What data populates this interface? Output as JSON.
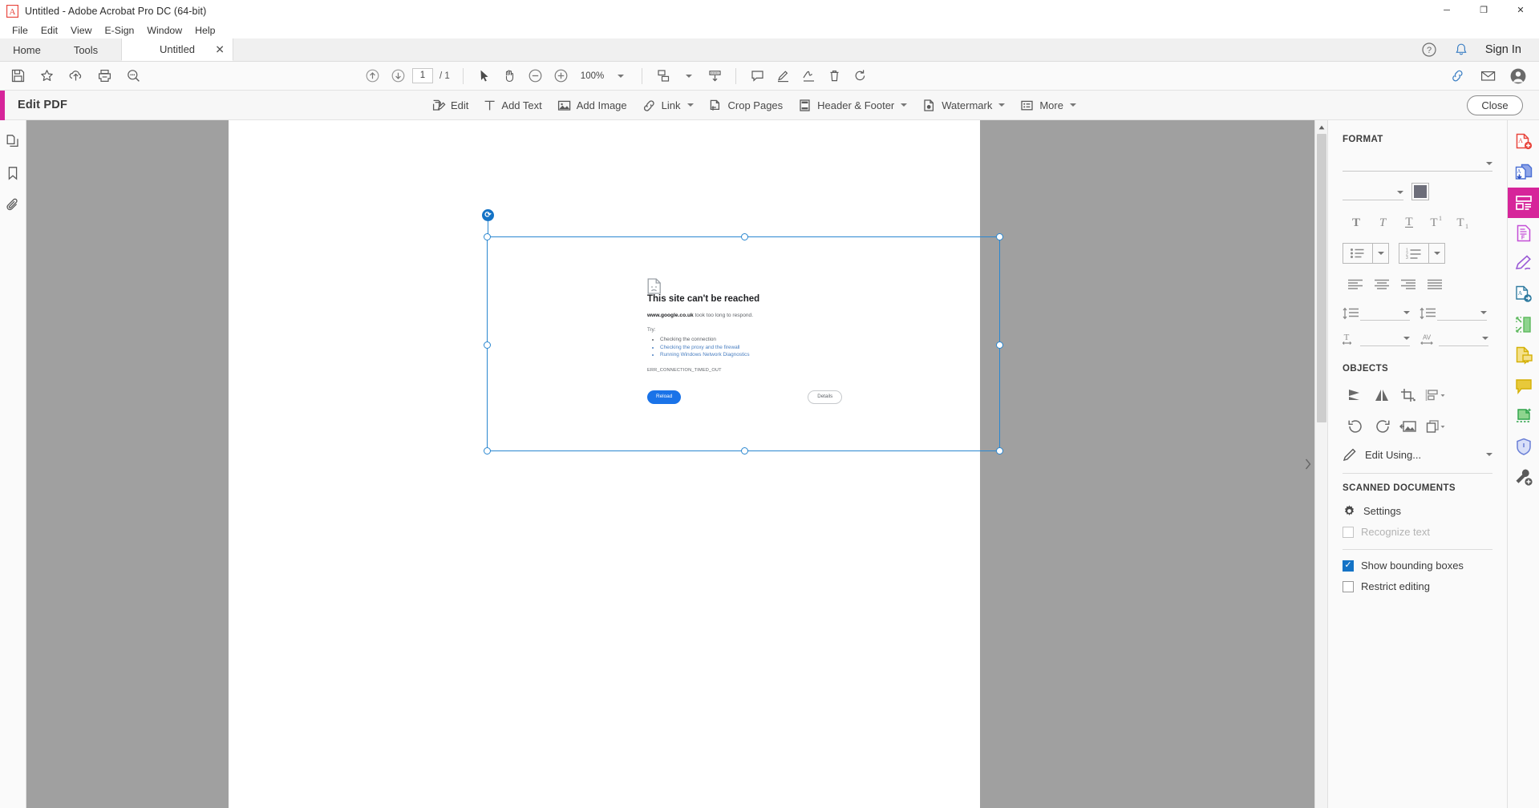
{
  "window": {
    "title": "Untitled - Adobe Acrobat Pro DC (64-bit)",
    "minimize": "─",
    "maximize": "❐",
    "close": "✕"
  },
  "menubar": {
    "items": [
      "File",
      "Edit",
      "View",
      "E-Sign",
      "Window",
      "Help"
    ]
  },
  "tabs": {
    "home": "Home",
    "tools": "Tools",
    "document": "Untitled",
    "close_glyph": "✕",
    "sign_in": "Sign In"
  },
  "toolbar": {
    "save_icon": "save-icon",
    "star_icon": "star-icon",
    "cloud_upload_icon": "cloud-upload-icon",
    "print_icon": "print-icon",
    "find_icon": "find-icon",
    "prev_page_icon": "arrow-up-circle-icon",
    "next_page_icon": "arrow-down-circle-icon",
    "page_number": "1",
    "page_total": "/ 1",
    "select_tool_icon": "cursor-icon",
    "hand_tool_icon": "hand-icon",
    "zoom_out_icon": "zoom-out-icon",
    "zoom_in_icon": "zoom-in-icon",
    "zoom_level": "100%",
    "fit_page_icon": "fit-page-icon",
    "scroll_mode_icon": "scroll-mode-icon",
    "comment_icon": "comment-icon",
    "highlight_icon": "highlight-pen-icon",
    "sign_icon": "sign-icon",
    "delete_icon": "trash-icon",
    "rotate_icon": "rotate-icon",
    "link_share_icon": "share-link-icon",
    "email_icon": "envelope-icon",
    "account_icon": "account-icon"
  },
  "editbar": {
    "title": "Edit PDF",
    "tools": [
      {
        "label": "Edit",
        "icon": "edit-pdf-icon",
        "caret": false
      },
      {
        "label": "Add Text",
        "icon": "add-text-icon",
        "caret": false
      },
      {
        "label": "Add Image",
        "icon": "add-image-icon",
        "caret": false
      },
      {
        "label": "Link",
        "icon": "link-icon",
        "caret": true
      },
      {
        "label": "Crop Pages",
        "icon": "crop-pages-icon",
        "caret": false
      },
      {
        "label": "Header & Footer",
        "icon": "header-footer-icon",
        "caret": true
      },
      {
        "label": "Watermark",
        "icon": "watermark-icon",
        "caret": true
      },
      {
        "label": "More",
        "icon": "more-list-icon",
        "caret": true
      }
    ],
    "close_label": "Close"
  },
  "leftrail": {
    "items": [
      {
        "name": "page-thumbnails-icon"
      },
      {
        "name": "bookmarks-icon"
      },
      {
        "name": "attachments-icon"
      }
    ]
  },
  "document": {
    "error": {
      "icon": "sad-page-icon",
      "title": "This site can't be reached",
      "subject_host": "www.google.co.uk",
      "subject_rest": " took too long to respond.",
      "try_label": "Try:",
      "suggestions": [
        {
          "text": "Checking the connection",
          "link": false
        },
        {
          "text": "Checking the proxy and the firewall",
          "link": true
        },
        {
          "text": "Running Windows Network Diagnostics",
          "link": true
        }
      ],
      "error_code": "ERR_CONNECTION_TIMED_OUT",
      "reload_button": "Reload",
      "details_button": "Details"
    },
    "rotate_handle_glyph": "⟳"
  },
  "format_panel": {
    "format_title": "FORMAT",
    "font_family_value": "",
    "font_size_value": "",
    "color_swatch": "#6d6e7a",
    "text_styles": [
      {
        "name": "bold-icon",
        "glyph": "T"
      },
      {
        "name": "italic-icon",
        "glyph": "T"
      },
      {
        "name": "underline-icon",
        "glyph": "T"
      },
      {
        "name": "superscript-icon",
        "glyph": "T"
      },
      {
        "name": "subscript-icon",
        "glyph": "T"
      }
    ],
    "list_buttons": [
      {
        "name": "bulleted-list-button"
      },
      {
        "name": "numbered-list-button"
      }
    ],
    "align_buttons": [
      {
        "name": "align-left-button"
      },
      {
        "name": "align-center-button"
      },
      {
        "name": "align-right-button"
      },
      {
        "name": "align-justify-button"
      }
    ],
    "spacing_controls": [
      {
        "name": "line-spacing-control",
        "value": ""
      },
      {
        "name": "paragraph-spacing-control",
        "value": ""
      },
      {
        "name": "horizontal-scale-control",
        "value": ""
      },
      {
        "name": "character-spacing-control",
        "value": "",
        "glyph": "AV"
      }
    ],
    "objects_title": "OBJECTS",
    "object_buttons": [
      {
        "name": "flip-vertical-button"
      },
      {
        "name": "flip-horizontal-button"
      },
      {
        "name": "crop-image-button"
      },
      {
        "name": "arrange-align-button"
      },
      {
        "name": "rotate-counterclockwise-button"
      },
      {
        "name": "rotate-clockwise-button"
      },
      {
        "name": "replace-image-button"
      },
      {
        "name": "arrange-order-button"
      }
    ],
    "edit_using_label": "Edit Using...",
    "scanned_title": "SCANNED DOCUMENTS",
    "settings_label": "Settings",
    "recognize_text_label": "Recognize text",
    "recognize_text_checked": false,
    "show_bounding_boxes_label": "Show bounding boxes",
    "show_bounding_boxes_checked": true,
    "restrict_editing_label": "Restrict editing",
    "restrict_editing_checked": false
  },
  "toolrail": {
    "items": [
      {
        "name": "create-pdf-icon",
        "color": "#e8453c",
        "active": false
      },
      {
        "name": "export-pdf-icon",
        "color": "#4a6fd4",
        "active": false
      },
      {
        "name": "edit-pdf-icon",
        "color": "#d6259a",
        "active": true
      },
      {
        "name": "fill-sign-form-icon",
        "color": "#c44dd6",
        "active": false
      },
      {
        "name": "sign-pen-icon",
        "color": "#9a5ad6",
        "active": false
      },
      {
        "name": "send-for-signature-icon",
        "color": "#2f7ba0",
        "active": false
      },
      {
        "name": "compress-pdf-icon",
        "color": "#5cb85c",
        "active": false
      },
      {
        "name": "comment-doc-icon",
        "color": "#d4b005",
        "active": false
      },
      {
        "name": "add-comment-icon",
        "color": "#d4b005",
        "active": false
      },
      {
        "name": "enhance-scan-icon",
        "color": "#2ea34a",
        "active": false
      },
      {
        "name": "protect-shield-icon",
        "color": "#6a7fd6",
        "active": false
      },
      {
        "name": "more-tools-icon",
        "color": "#5a5a5a",
        "active": false
      }
    ]
  },
  "scrollbar": {
    "up_glyph": "▲",
    "down_glyph": "▼"
  }
}
